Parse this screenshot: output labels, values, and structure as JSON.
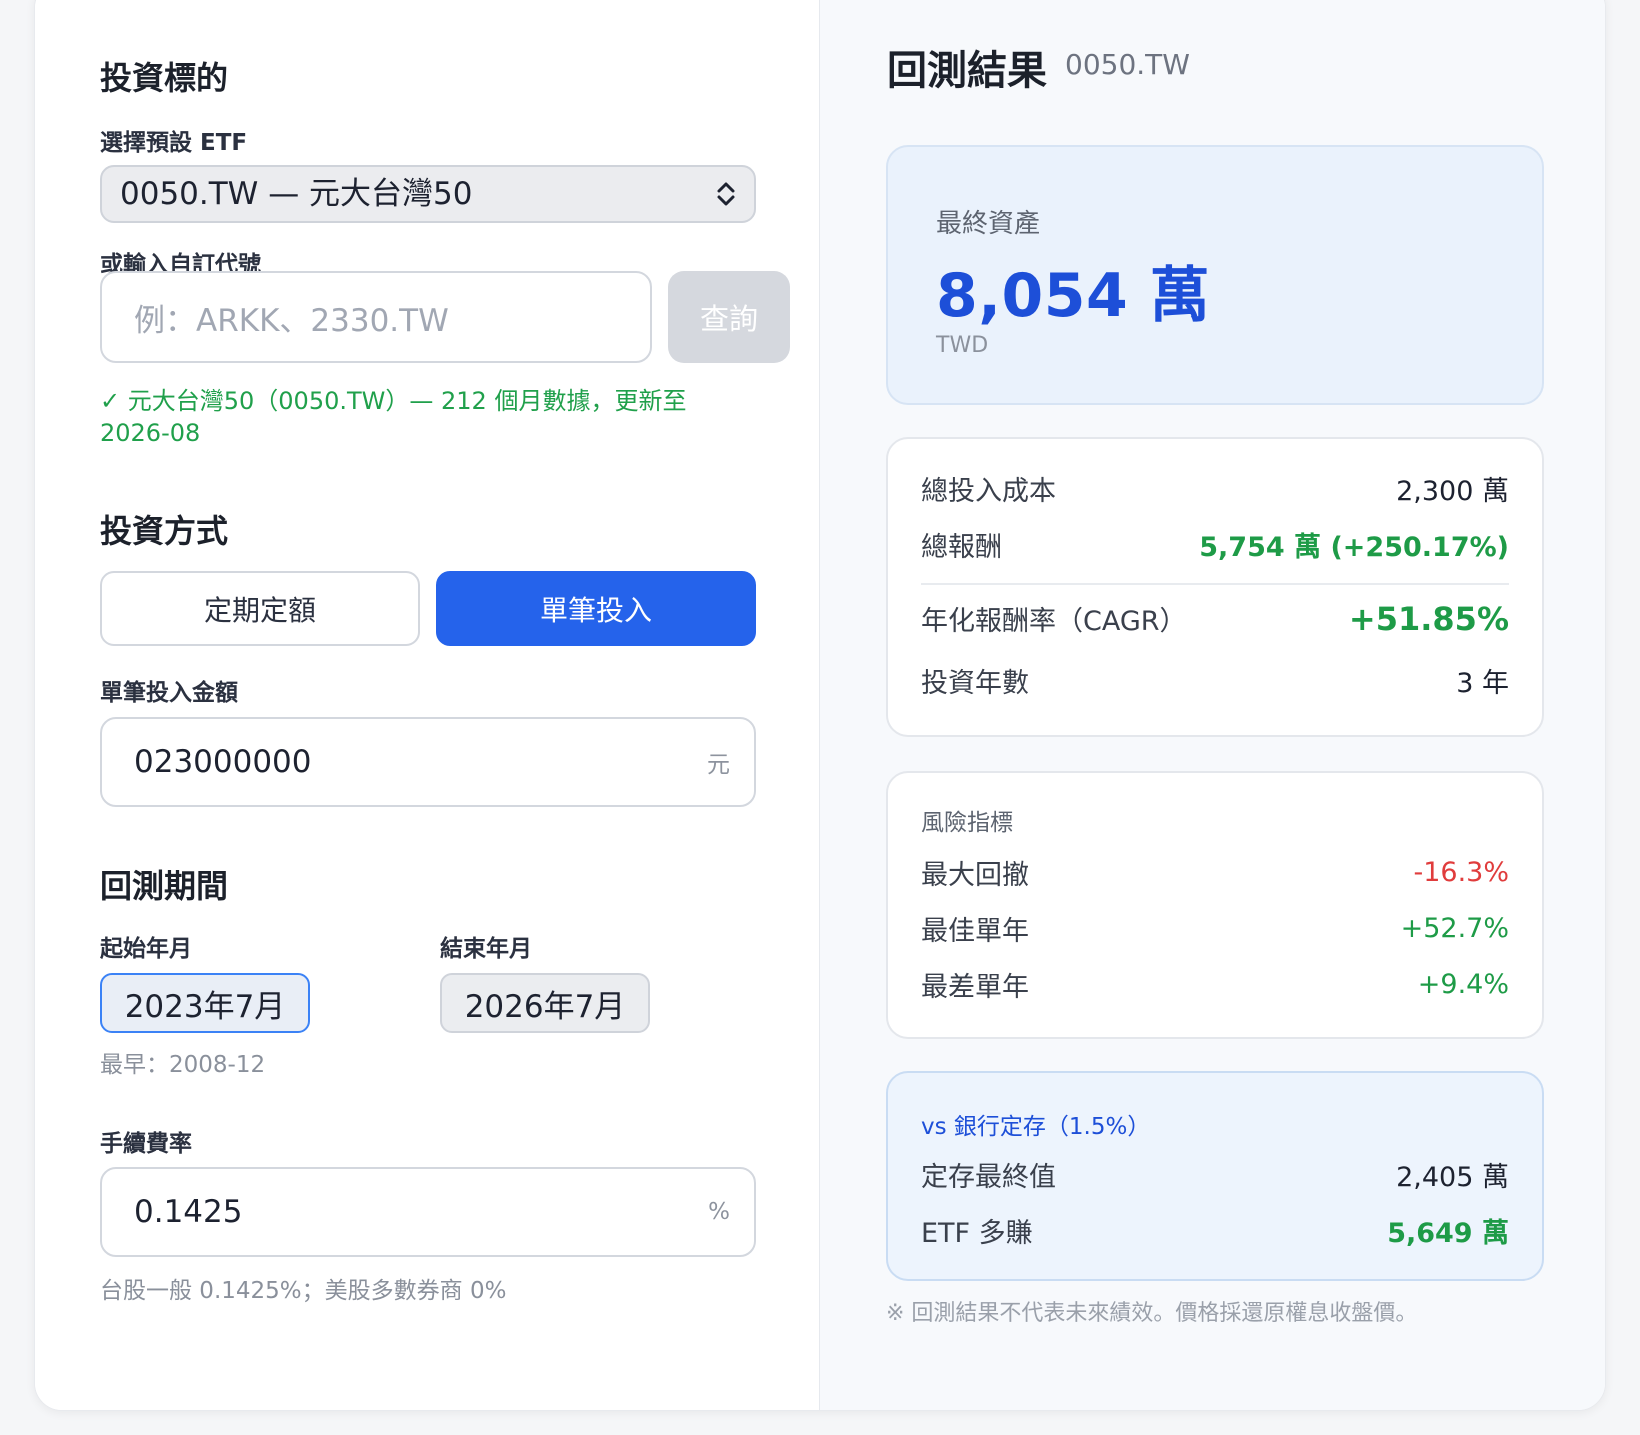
{
  "target": {
    "section_title": "投資標的",
    "preset_label": "選擇預設 ETF",
    "preset_value": "0050.TW — 元大台灣50",
    "custom_label": "或輸入自訂代號",
    "custom_placeholder": "例：ARKK、2330.TW",
    "query_button": "查詢",
    "status_message": "✓ 元大台灣50（0050.TW）— 212 個月數據，更新至 2026-08"
  },
  "method": {
    "section_title": "投資方式",
    "option_periodic": "定期定額",
    "option_lump_sum": "單筆投入",
    "selected": "單筆投入",
    "amount_label": "單筆投入金額",
    "amount_value": "023000000",
    "amount_unit": "元"
  },
  "period": {
    "section_title": "回測期間",
    "start_label": "起始年月",
    "start_value": "2023年7月",
    "end_label": "結束年月",
    "end_value": "2026年7月",
    "earliest_hint": "最早：2008-12"
  },
  "fee": {
    "label": "手續費率",
    "value": "0.1425",
    "unit": "%",
    "hint": "台股一般 0.1425%；美股多數券商 0%"
  },
  "results": {
    "title": "回測結果",
    "ticker": "0050.TW",
    "final_label": "最終資產",
    "final_value": "8,054 萬",
    "final_currency": "TWD",
    "cost_label": "總投入成本",
    "cost_value": "2,300 萬",
    "return_label": "總報酬",
    "return_value": "5,754 萬 (+250.17%)",
    "cagr_label": "年化報酬率（CAGR）",
    "cagr_value": "+51.85%",
    "years_label": "投資年數",
    "years_value": "3 年"
  },
  "risk": {
    "title": "風險指標",
    "max_dd_label": "最大回撤",
    "max_dd_value": "-16.3%",
    "best_year_label": "最佳單年",
    "best_year_value": "+52.7%",
    "worst_year_label": "最差單年",
    "worst_year_value": "+9.4%"
  },
  "bank": {
    "title": "vs 銀行定存（1.5%）",
    "final_label": "定存最終值",
    "final_value": "2,405 萬",
    "extra_label": "ETF 多賺",
    "extra_value": "5,649 萬"
  },
  "disclaimer": "※ 回測結果不代表未來績效。價格採還原權息收盤價。",
  "colors": {
    "accent": "#2563eb",
    "positive": "#1e9b47",
    "negative": "#e03c3c",
    "big_value": "#1d4fd8"
  }
}
